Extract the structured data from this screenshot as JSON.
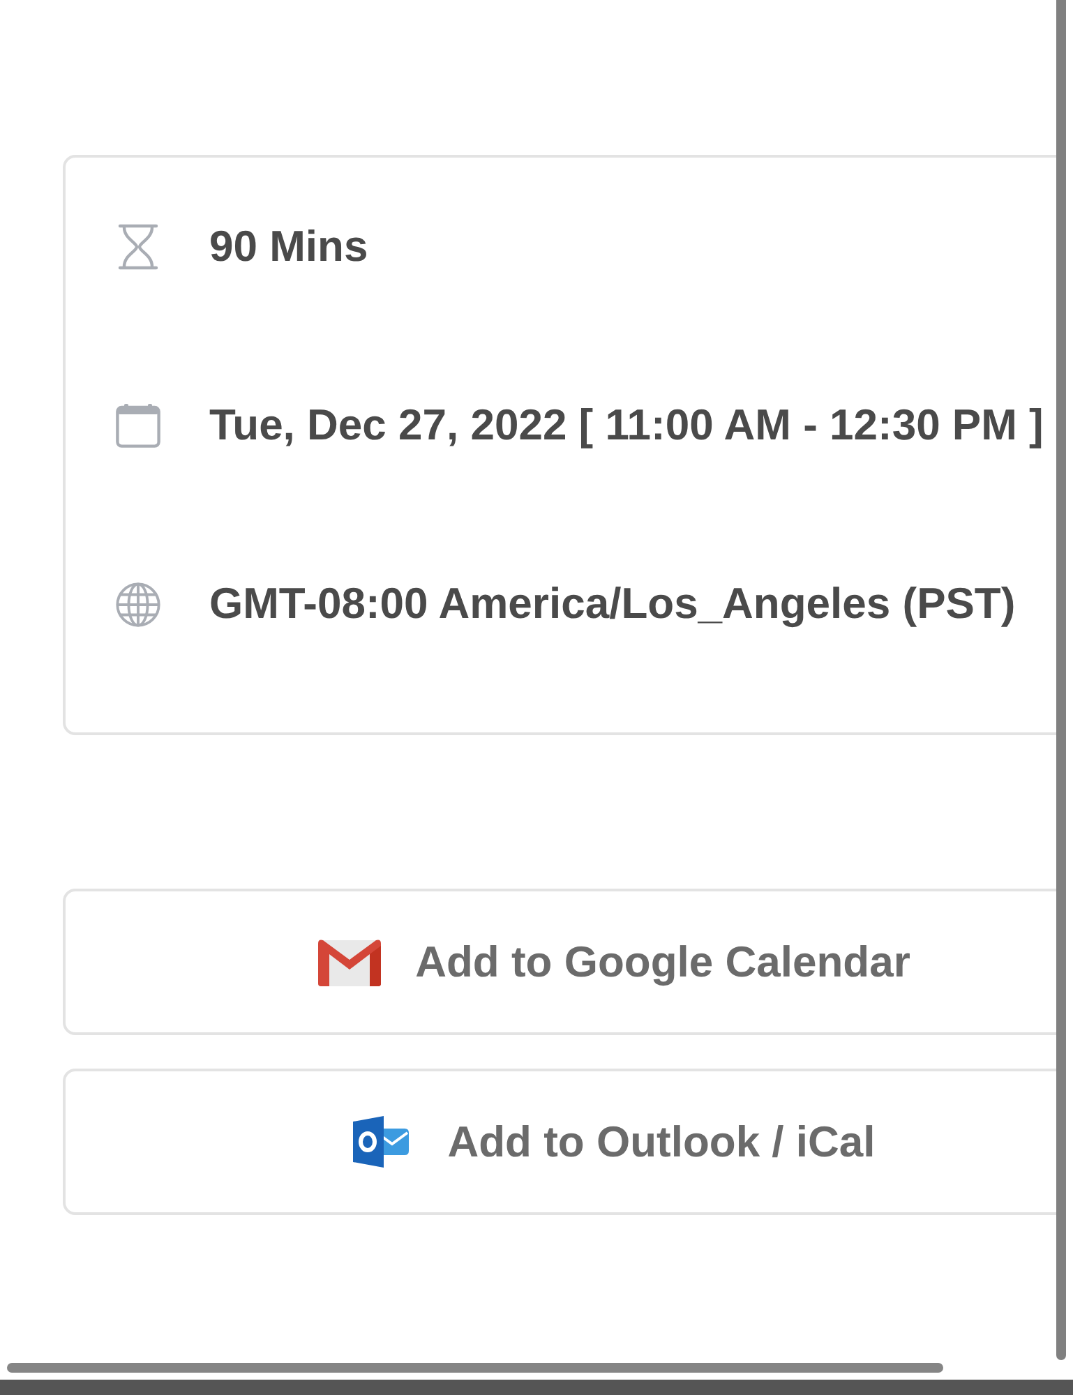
{
  "details": [
    {
      "kind": "duration",
      "text": "90 Mins"
    },
    {
      "kind": "date",
      "text": "Tue, Dec 27, 2022 [ 11:00 AM - 12:30 PM ]"
    },
    {
      "kind": "timezone",
      "text": "GMT-08:00 America/Los_Angeles (PST)"
    }
  ],
  "buttons": [
    {
      "kind": "google",
      "label": "Add to Google Calendar"
    },
    {
      "kind": "outlook",
      "label": "Add to Outlook / iCal"
    }
  ]
}
